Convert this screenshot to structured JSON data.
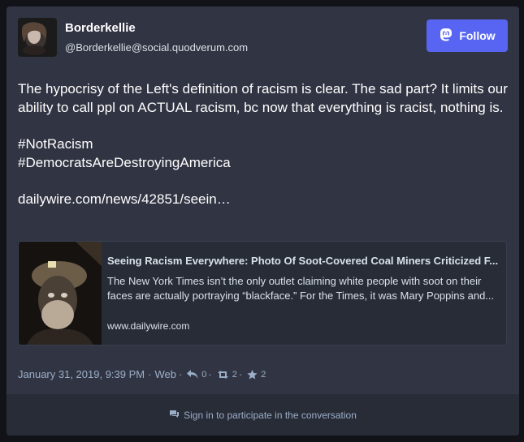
{
  "account": {
    "display_name": "Borderkellie",
    "handle": "@Borderkellie@social.quodverum.com"
  },
  "follow": {
    "label": "Follow",
    "icon": "mastodon-icon"
  },
  "status": {
    "text": "The hypocrisy of the Left's definition of racism is clear. The sad part? It limits our ability to call ppl on ACTUAL racism, bc now that everything is racist, nothing is.",
    "hashtags": [
      "#NotRacism",
      "#DemocratsAreDestroyingAmerica"
    ],
    "link": "dailywire.com/news/42851/seein…"
  },
  "preview_card": {
    "title": "Seeing Racism Everywhere: Photo Of Soot-Covered Coal Miners Criticized F...",
    "description": "The New York Times isn’t the only outlet claiming white people with soot on their faces are actually portraying “blackface.” For the Times, it was Mary Poppins and...",
    "host": "www.dailywire.com"
  },
  "meta": {
    "timestamp": "January 31, 2019, 9:39 PM",
    "separator": "·",
    "application": "Web",
    "replies": "0",
    "reblogs": "2",
    "favourites": "2"
  },
  "footer": {
    "label": "Sign in to participate in the conversation"
  },
  "colors": {
    "card_bg": "#313543",
    "footer_bg": "#282c37",
    "accent": "#5865f2",
    "muted_text": "#9baec8"
  }
}
